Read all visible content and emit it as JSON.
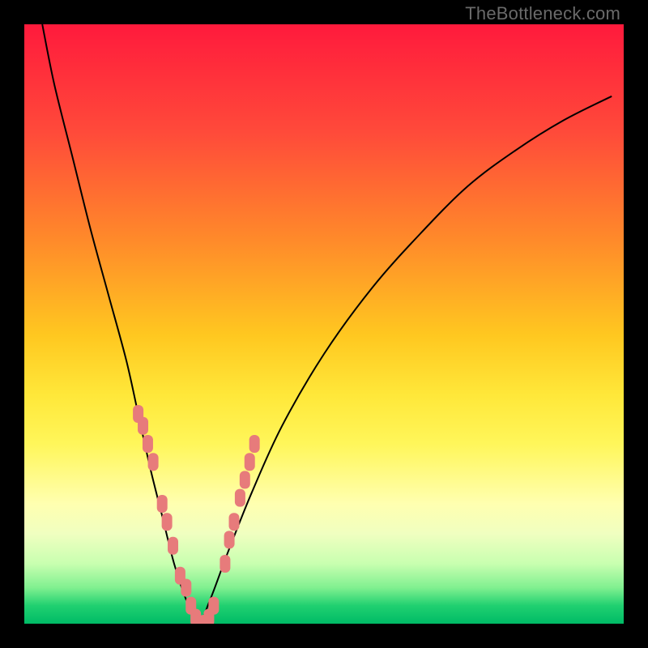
{
  "watermark": {
    "text": "TheBottleneck.com"
  },
  "chart_data": {
    "type": "line",
    "title": "",
    "xlabel": "",
    "ylabel": "",
    "xlim": [
      0,
      100
    ],
    "ylim": [
      0,
      100
    ],
    "grid": false,
    "series": [
      {
        "name": "bottleneck-curve",
        "x": [
          3,
          5,
          8,
          11,
          14,
          17,
          19,
          21,
          23,
          25,
          27,
          29,
          31,
          34,
          38,
          43,
          50,
          58,
          66,
          74,
          82,
          90,
          98
        ],
        "values": [
          100,
          90,
          78,
          66,
          55,
          44,
          35,
          26,
          18,
          10,
          4,
          0,
          4,
          12,
          22,
          33,
          45,
          56,
          65,
          73,
          79,
          84,
          88
        ]
      }
    ],
    "markers": {
      "name": "highlighted-points",
      "color": "#e77b7b",
      "points": [
        {
          "x": 19.0,
          "y": 35
        },
        {
          "x": 19.8,
          "y": 33
        },
        {
          "x": 20.6,
          "y": 30
        },
        {
          "x": 21.5,
          "y": 27
        },
        {
          "x": 23.0,
          "y": 20
        },
        {
          "x": 23.8,
          "y": 17
        },
        {
          "x": 24.8,
          "y": 13
        },
        {
          "x": 26.0,
          "y": 8
        },
        {
          "x": 27.0,
          "y": 6
        },
        {
          "x": 27.8,
          "y": 3
        },
        {
          "x": 28.6,
          "y": 1
        },
        {
          "x": 29.2,
          "y": 0
        },
        {
          "x": 30.0,
          "y": 0
        },
        {
          "x": 30.8,
          "y": 1
        },
        {
          "x": 31.6,
          "y": 3
        },
        {
          "x": 33.5,
          "y": 10
        },
        {
          "x": 34.2,
          "y": 14
        },
        {
          "x": 35.0,
          "y": 17
        },
        {
          "x": 36.0,
          "y": 21
        },
        {
          "x": 36.8,
          "y": 24
        },
        {
          "x": 37.6,
          "y": 27
        },
        {
          "x": 38.4,
          "y": 30
        }
      ]
    }
  }
}
